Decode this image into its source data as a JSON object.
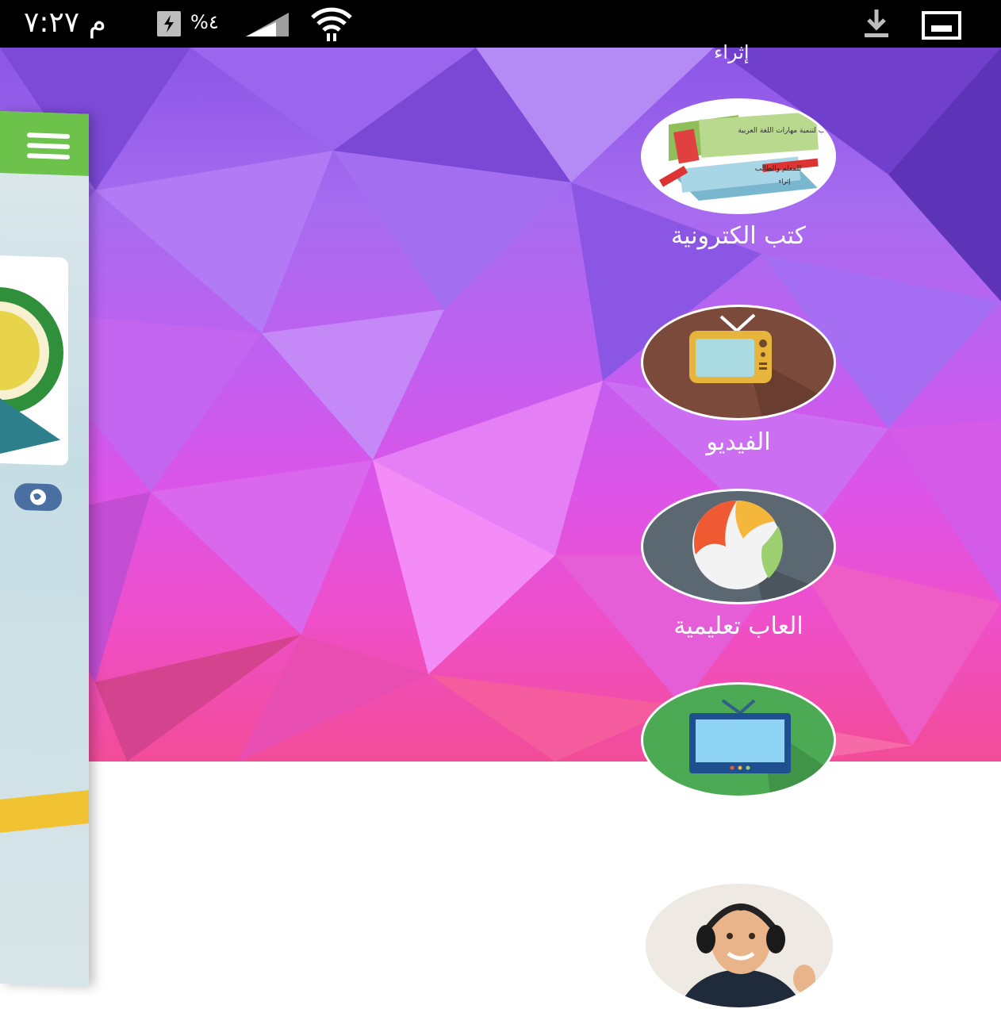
{
  "status_bar": {
    "time": "م ٧:٢٧",
    "battery": "%٤"
  },
  "menu": {
    "top_partial_label": "إثراء",
    "items": [
      {
        "label": "كتب الكترونية",
        "icon": "books-icon",
        "book_title": "كتب لتنمية مهارات اللغة العربية",
        "book_subtitle": "للمعلم والطالب",
        "book_tag": "إثراء"
      },
      {
        "label": "الفيديو",
        "icon": "retro-tv-icon"
      },
      {
        "label": "العاب تعليمية",
        "icon": "beach-ball-icon"
      },
      {
        "label": "",
        "icon": "blue-tv-icon"
      }
    ]
  },
  "drawer": {
    "menu_icon": "hamburger-icon",
    "globe_icon": "globe-icon"
  },
  "avatar": {
    "icon": "child-headphones-avatar"
  },
  "colors": {
    "status_bar": "#000000",
    "drawer_accent": "#6cc24a",
    "hero_top": "#8b55e6",
    "hero_bottom": "#f24c98",
    "tv_bg": "#7b4a3a",
    "ball_bg": "#5b6872",
    "green_tv_bg": "#4caa55"
  }
}
